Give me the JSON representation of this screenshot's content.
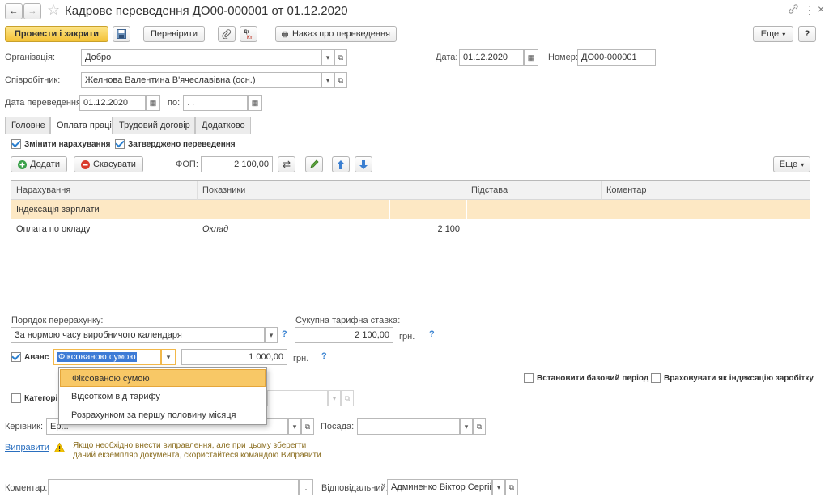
{
  "header": {
    "title": "Кадрове переведення ДО00-000001 от 01.12.2020",
    "back_glyph": "←",
    "forward_glyph": "→",
    "star_glyph": "☆",
    "link_glyph": "🔗",
    "more_glyph": "⋮",
    "close_glyph": "×"
  },
  "toolbar": {
    "post_close_label": "Провести і закрити",
    "check_label": "Перевірити",
    "order_label": "Наказ про переведення",
    "more_label": "Еще",
    "help_label": "?"
  },
  "form": {
    "org_label": "Організація:",
    "org_value": "Добро",
    "date_label": "Дата:",
    "date_value": "01.12.2020",
    "number_label": "Номер:",
    "number_value": "ДО00-000001",
    "employee_label": "Співробітник:",
    "employee_value": "Желнова Валентина В'ячеславівна (осн.)",
    "transfer_date_label": "Дата переведення:",
    "transfer_date_value": "01.12.2020",
    "to_label": "по:",
    "to_value": " .  ."
  },
  "tabs": [
    {
      "label": "Головне"
    },
    {
      "label": "Оплата праці"
    },
    {
      "label": "Трудовий договір"
    },
    {
      "label": "Додатково"
    }
  ],
  "pay": {
    "change_accruals_label": "Змінити нарахування",
    "approved_label": "Затверджено переведення",
    "add_label": "Додати",
    "cancel_label": "Скасувати",
    "fop_label": "ФОП:",
    "fop_value": "2 100,00",
    "more_label": "Еще"
  },
  "grid": {
    "columns": [
      "Нарахування",
      "Показники",
      "Підстава",
      "Коментар"
    ],
    "rows": [
      {
        "name": "Індексація зарплати",
        "indicator": "",
        "value": "",
        "basis": "",
        "comment": ""
      },
      {
        "name": "Оплата по окладу",
        "indicator": "Оклад",
        "value": "2 100",
        "basis": "",
        "comment": ""
      }
    ]
  },
  "recalc": {
    "order_label": "Порядок перерахунку:",
    "order_value": "За нормою часу виробничого календаря",
    "total_rate_label": "Сукупна тарифна ставка:",
    "total_rate_value": "2 100,00",
    "currency": "грн.",
    "hint": "?"
  },
  "advance": {
    "label": "Аванс",
    "mode_value": "Фіксованою сумою",
    "amount_value": "1 000,00",
    "currency": "грн.",
    "hint": "?",
    "options": [
      "Фіксованою сумою",
      "Відсотком від тарифу",
      "Розрахунком за першу половину місяця"
    ]
  },
  "period": {
    "base_period_label": "Встановити базовий період",
    "indexation_label": "Враховувати як індексацію заробітку"
  },
  "category": {
    "label": "Категорі"
  },
  "manager": {
    "label": "Керівник:",
    "value": "Ер...",
    "position_label": "Посада:",
    "position_value": ""
  },
  "correction": {
    "link_label": "Виправити",
    "message_line1": "Якщо необхідно внести виправлення, але при цьому зберегти",
    "message_line2": "даний екземпляр документа, скористайтеся командою Виправити"
  },
  "footer": {
    "comment_label": "Коментар:",
    "comment_value": "",
    "ellipsis": "...",
    "responsible_label": "Відповідальний:",
    "responsible_value": "Админенко Віктор Сергійо"
  },
  "colors": {
    "accent_orange": "#f3c237",
    "selection": "#fde8c4",
    "hint_blue": "#3a83d1",
    "warning_yellow": "#f2c200"
  }
}
